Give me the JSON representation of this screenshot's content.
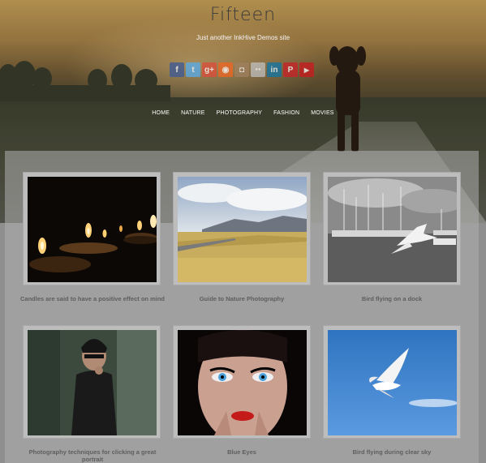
{
  "site": {
    "title": "Fifteen",
    "description": "Just another InkHive Demos site"
  },
  "social": [
    {
      "name": "facebook",
      "glyph": "f",
      "color": "#3b5998"
    },
    {
      "name": "twitter",
      "glyph": "t",
      "color": "#55acee"
    },
    {
      "name": "google-plus",
      "glyph": "g+",
      "color": "#dd4b39"
    },
    {
      "name": "rss",
      "glyph": "◉",
      "color": "#f26522"
    },
    {
      "name": "instagram",
      "glyph": "◘",
      "color": "#a08060"
    },
    {
      "name": "flickr",
      "glyph": "●●",
      "color": "#c0c0c0"
    },
    {
      "name": "linkedin",
      "glyph": "in",
      "color": "#0e76a8"
    },
    {
      "name": "pinterest",
      "glyph": "P",
      "color": "#cb2027"
    },
    {
      "name": "youtube",
      "glyph": "▶",
      "color": "#cc181e"
    }
  ],
  "nav": [
    {
      "label": "HOME"
    },
    {
      "label": "NATURE"
    },
    {
      "label": "PHOTOGRAPHY"
    },
    {
      "label": "FASHION"
    },
    {
      "label": "MOVIES"
    }
  ],
  "posts": [
    {
      "title": "Candles are said to have a positive effect on mind"
    },
    {
      "title": "Guide to Nature Photography"
    },
    {
      "title": "Bird flying on a dock"
    },
    {
      "title": "Photography techniques for clicking a great portrait"
    },
    {
      "title": "Blue Eyes"
    },
    {
      "title": "Bird flying during clear sky"
    }
  ]
}
